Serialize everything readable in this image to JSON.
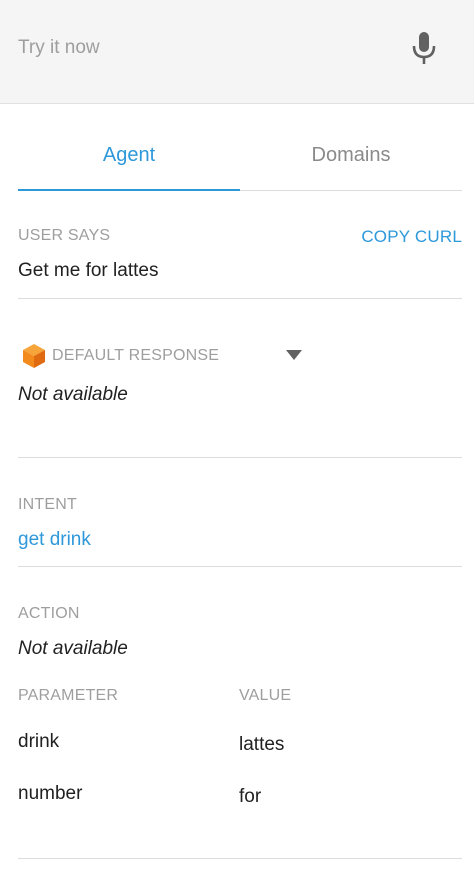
{
  "try_bar": {
    "placeholder": "Try it now",
    "mic_icon": "microphone-icon"
  },
  "tabs": [
    {
      "label": "Agent",
      "active": true
    },
    {
      "label": "Domains",
      "active": false
    }
  ],
  "user_says": {
    "label": "USER SAYS",
    "copy_curl": "COPY CURL",
    "text": "Get me for lattes"
  },
  "default_response": {
    "icon": "cube-icon",
    "label": "DEFAULT RESPONSE",
    "dropdown_icon": "caret-down-icon",
    "value": "Not available"
  },
  "intent": {
    "label": "INTENT",
    "value": "get drink"
  },
  "action": {
    "label": "ACTION",
    "value": "Not available"
  },
  "parameters": {
    "header_parameter": "PARAMETER",
    "header_value": "VALUE",
    "rows": [
      {
        "name": "drink",
        "value": "lattes"
      },
      {
        "name": "number",
        "value": "for"
      }
    ]
  },
  "colors": {
    "accent": "#2d98da",
    "label_gray": "#9e9e9e",
    "cube_orange": "#f28a1c"
  }
}
